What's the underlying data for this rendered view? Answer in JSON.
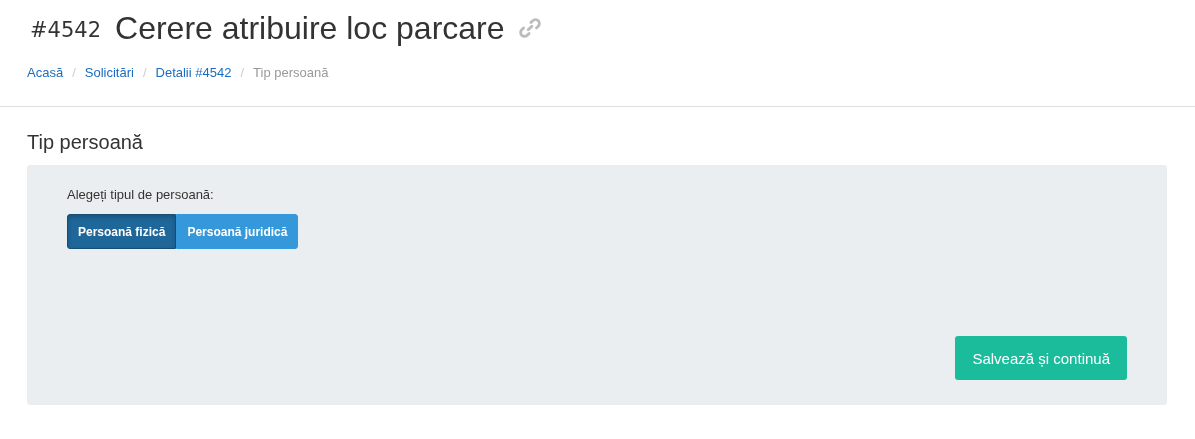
{
  "header": {
    "number": "#4542",
    "title": "Cerere atribuire loc parcare"
  },
  "breadcrumb_separator": "/",
  "breadcrumb": [
    {
      "label": "Acasă",
      "current": false
    },
    {
      "label": "Solicitări",
      "current": false
    },
    {
      "label": "Detalii #4542",
      "current": false
    },
    {
      "label": "Tip persoană",
      "current": true
    }
  ],
  "section": {
    "title": "Tip persoană",
    "prompt": "Alegeți tipul de persoană:",
    "options": [
      {
        "label": "Persoană fizică",
        "selected": true
      },
      {
        "label": "Persoană juridică",
        "selected": false
      }
    ],
    "submit": "Salvează și continuă"
  }
}
